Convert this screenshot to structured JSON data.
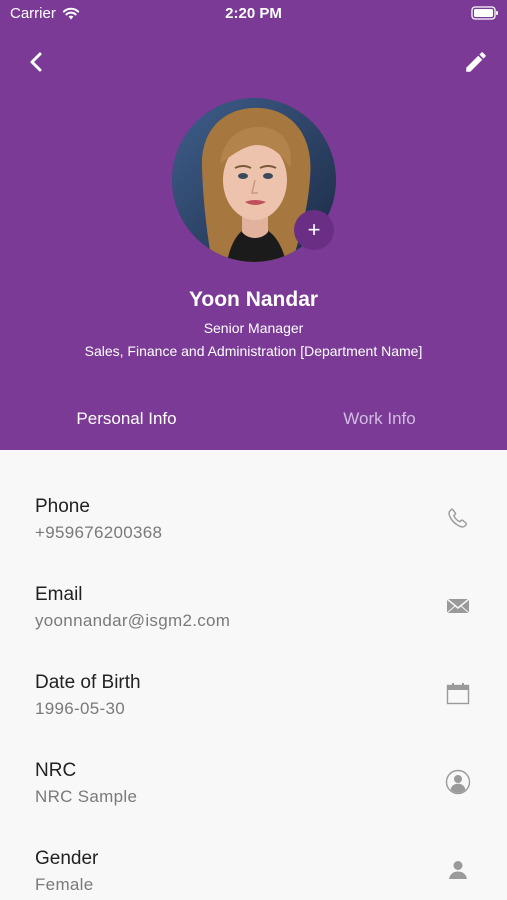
{
  "status_bar": {
    "carrier": "Carrier",
    "time": "2:20 PM"
  },
  "profile": {
    "name": "Yoon Nandar",
    "title": "Senior Manager",
    "department": "Sales, Finance and Administration [Department Name]",
    "add_photo_label": "+"
  },
  "tabs": [
    {
      "label": "Personal Info",
      "selected": true
    },
    {
      "label": "Work Info",
      "selected": false
    }
  ],
  "info_items": [
    {
      "label": "Phone",
      "value": "+959676200368",
      "icon": "phone-icon"
    },
    {
      "label": "Email",
      "value": "yoonnandar@isgm2.com",
      "icon": "mail-icon"
    },
    {
      "label": "Date of Birth",
      "value": "1996-05-30",
      "icon": "calendar-icon"
    },
    {
      "label": "NRC",
      "value": "NRC Sample",
      "icon": "id-icon"
    },
    {
      "label": "Gender",
      "value": "Female",
      "icon": "person-icon"
    }
  ],
  "colors": {
    "header_bg": "#7b3a96",
    "content_bg": "#f8f8f8",
    "label": "#222222",
    "value": "#7a7a7a",
    "icon": "#9a9a9a"
  }
}
